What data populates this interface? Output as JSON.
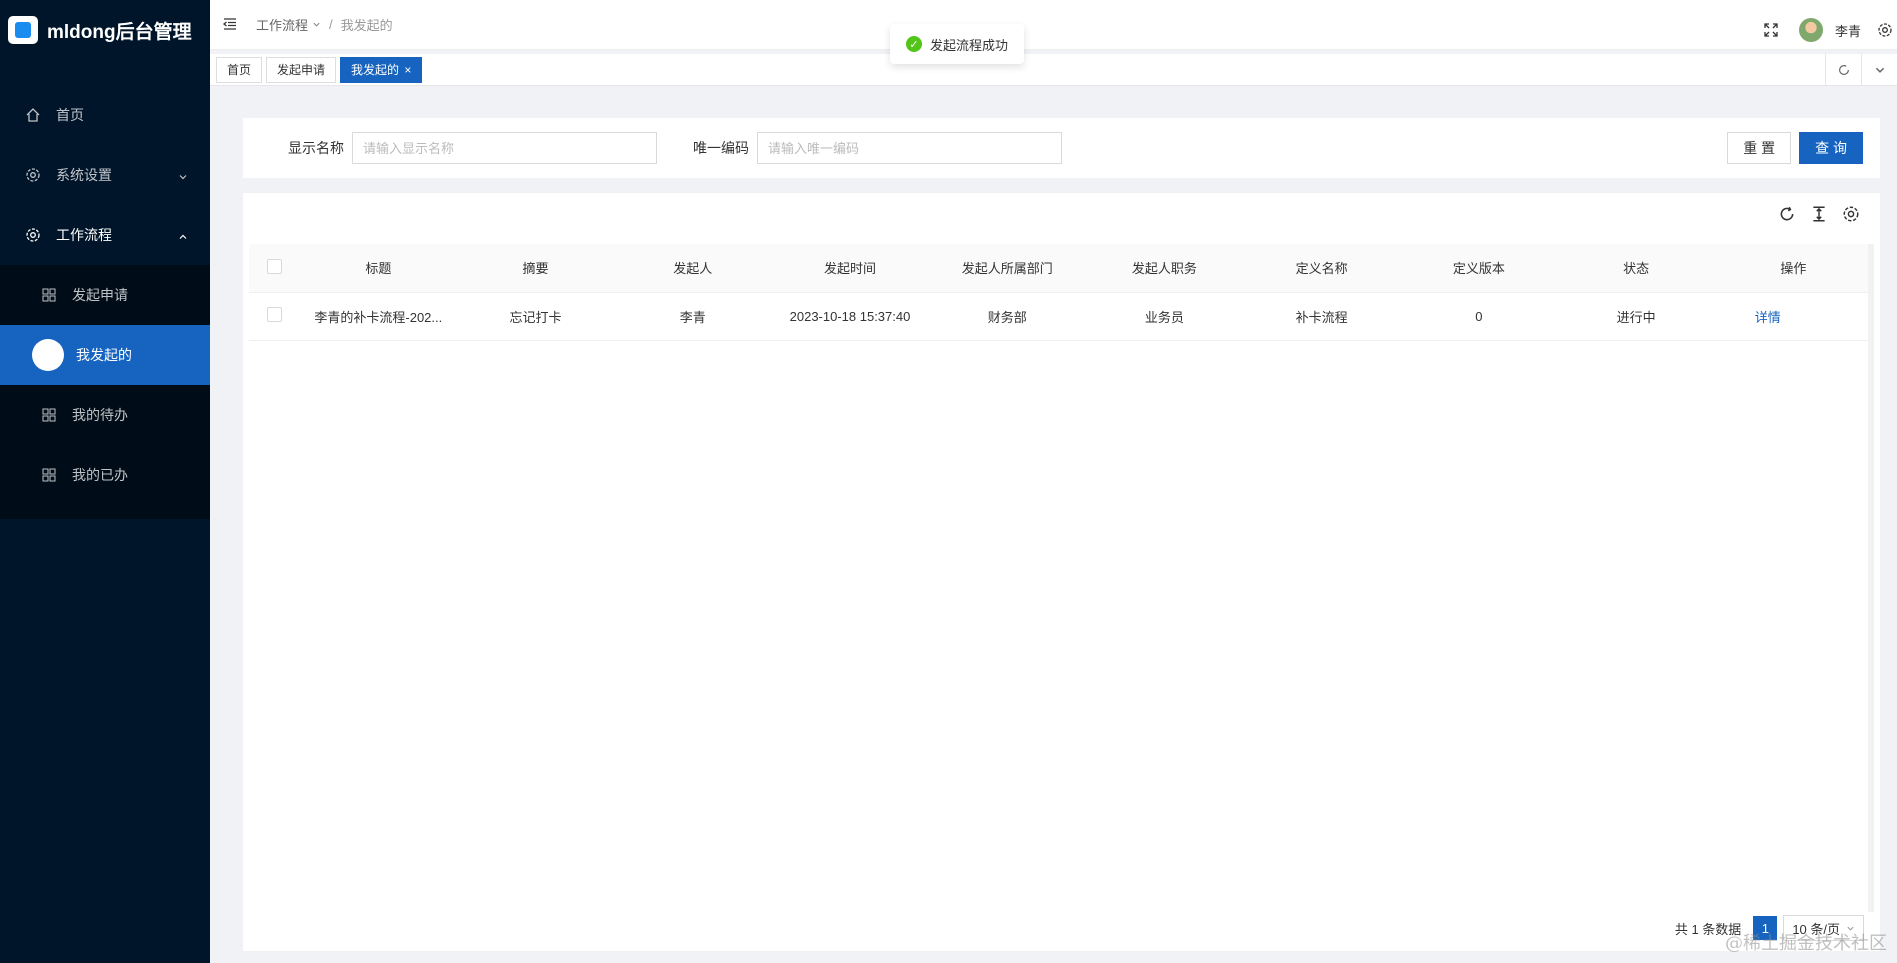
{
  "app": {
    "title": "mldong后台管理"
  },
  "sidebar": {
    "items": [
      {
        "label": "首页",
        "icon": "home-icon"
      },
      {
        "label": "系统设置",
        "icon": "gear-icon"
      },
      {
        "label": "工作流程",
        "icon": "gear-icon"
      }
    ],
    "submenu": [
      {
        "label": "发起申请",
        "icon": "grid-icon"
      },
      {
        "label": "我发起的",
        "icon": "circle-icon",
        "active": true
      },
      {
        "label": "我的待办",
        "icon": "grid-icon"
      },
      {
        "label": "我的已办",
        "icon": "grid-icon"
      }
    ]
  },
  "header": {
    "breadcrumb": [
      "工作流程",
      "我发起的"
    ],
    "username": "李青"
  },
  "tabs": [
    {
      "label": "首页"
    },
    {
      "label": "发起申请"
    },
    {
      "label": "我发起的",
      "close": "×",
      "active": true
    }
  ],
  "toast": {
    "message": "发起流程成功"
  },
  "search": {
    "name_label": "显示名称",
    "name_placeholder": "请输入显示名称",
    "code_label": "唯一编码",
    "code_placeholder": "请输入唯一编码",
    "reset_label": "重 置",
    "query_label": "查 询"
  },
  "table": {
    "columns": [
      "标题",
      "摘要",
      "发起人",
      "发起时间",
      "发起人所属部门",
      "发起人职务",
      "定义名称",
      "定义版本",
      "状态",
      "操作"
    ],
    "rows": [
      {
        "title": "李青的补卡流程-202...",
        "summary": "忘记打卡",
        "initiator": "李青",
        "time": "2023-10-18 15:37:40",
        "dept": "财务部",
        "position": "业务员",
        "def_name": "补卡流程",
        "def_version": "0",
        "status": "进行中",
        "action": "详情"
      }
    ]
  },
  "pagination": {
    "total_text": "共 1 条数据",
    "current": "1",
    "page_size": "10 条/页"
  },
  "watermark": "@稀土掘金技术社区",
  "colors": {
    "sidebar": "#001529",
    "primary": "#1664c0",
    "success": "#52c41a"
  }
}
